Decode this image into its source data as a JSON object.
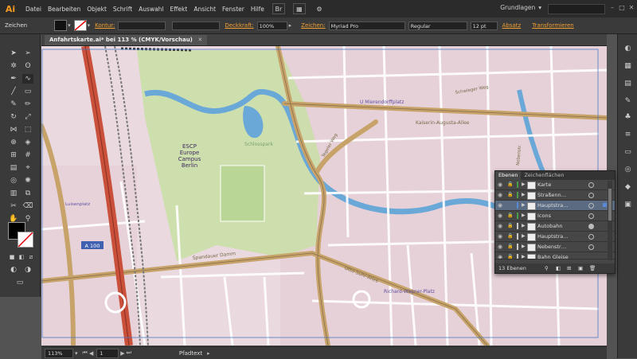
{
  "app": {
    "logo": "Ai"
  },
  "menu": [
    "Datei",
    "Bearbeiten",
    "Objekt",
    "Schrift",
    "Auswahl",
    "Effekt",
    "Ansicht",
    "Fenster",
    "Hilfe"
  ],
  "menu_icons": {
    "bridge": "Br"
  },
  "workspace": "Grundlagen",
  "control": {
    "selection_label": "Zeichen",
    "stroke_label": "Kontur:",
    "opacity_label": "Deckkraft:",
    "opacity_value": "100%",
    "char_label": "Zeichen:",
    "font_value": "Myriad Pro",
    "style_value": "Regular",
    "size_value": "12 pt",
    "paragraph_label": "Absatz",
    "transform_label": "Transformieren"
  },
  "document": {
    "tab_title": "Anfahrtskarte.ai* bei 113 % (CMYK/Vorschau)"
  },
  "map_labels": {
    "school": "ESCP\nEurope\nCampus\nBerlin",
    "park": "Schlosspark",
    "place1": "U Mierendorffplatz",
    "street1": "Kaiserin-Augusta-Allee",
    "street2": "Spandauer Damm",
    "place2": "Richard-Wagner-Platz",
    "street3": "Otto-Suhr-Allee",
    "highway": "A 100",
    "street4": "Schwieger Weg",
    "street5": "Tegeler Weg",
    "street6": "Luisenplatz",
    "street7": "Nebenstr."
  },
  "layers": {
    "tabs": [
      "Ebenen",
      "Zeichenflächen"
    ],
    "rows": [
      {
        "name": "Karte",
        "color": "#4c9e4c",
        "selected": false
      },
      {
        "name": "Straßenn…",
        "color": "#4c9e4c",
        "selected": false
      },
      {
        "name": "Hauptstra…",
        "color": "#5c88d8",
        "selected": true
      },
      {
        "name": "Icons",
        "color": "#4c9e4c",
        "selected": false
      },
      {
        "name": "Autobahn",
        "color": "#cccccc",
        "selected": false
      },
      {
        "name": "Hauptstra…",
        "color": "#cccccc",
        "selected": false
      },
      {
        "name": "Nebenstr…",
        "color": "#cccccc",
        "selected": false
      },
      {
        "name": "Bahn Gleise",
        "color": "#cccccc",
        "selected": false
      }
    ],
    "footer": "13 Ebenen"
  },
  "status": {
    "zoom": "113%",
    "page": "1",
    "tool": "Pfadtext"
  },
  "colors": {
    "accent": "#f0a030",
    "map_bg": "#ead9de",
    "park": "#c9dfa6",
    "water": "#6aa8d8",
    "main_road": "#c7a36a",
    "highway": "#c9503a"
  }
}
